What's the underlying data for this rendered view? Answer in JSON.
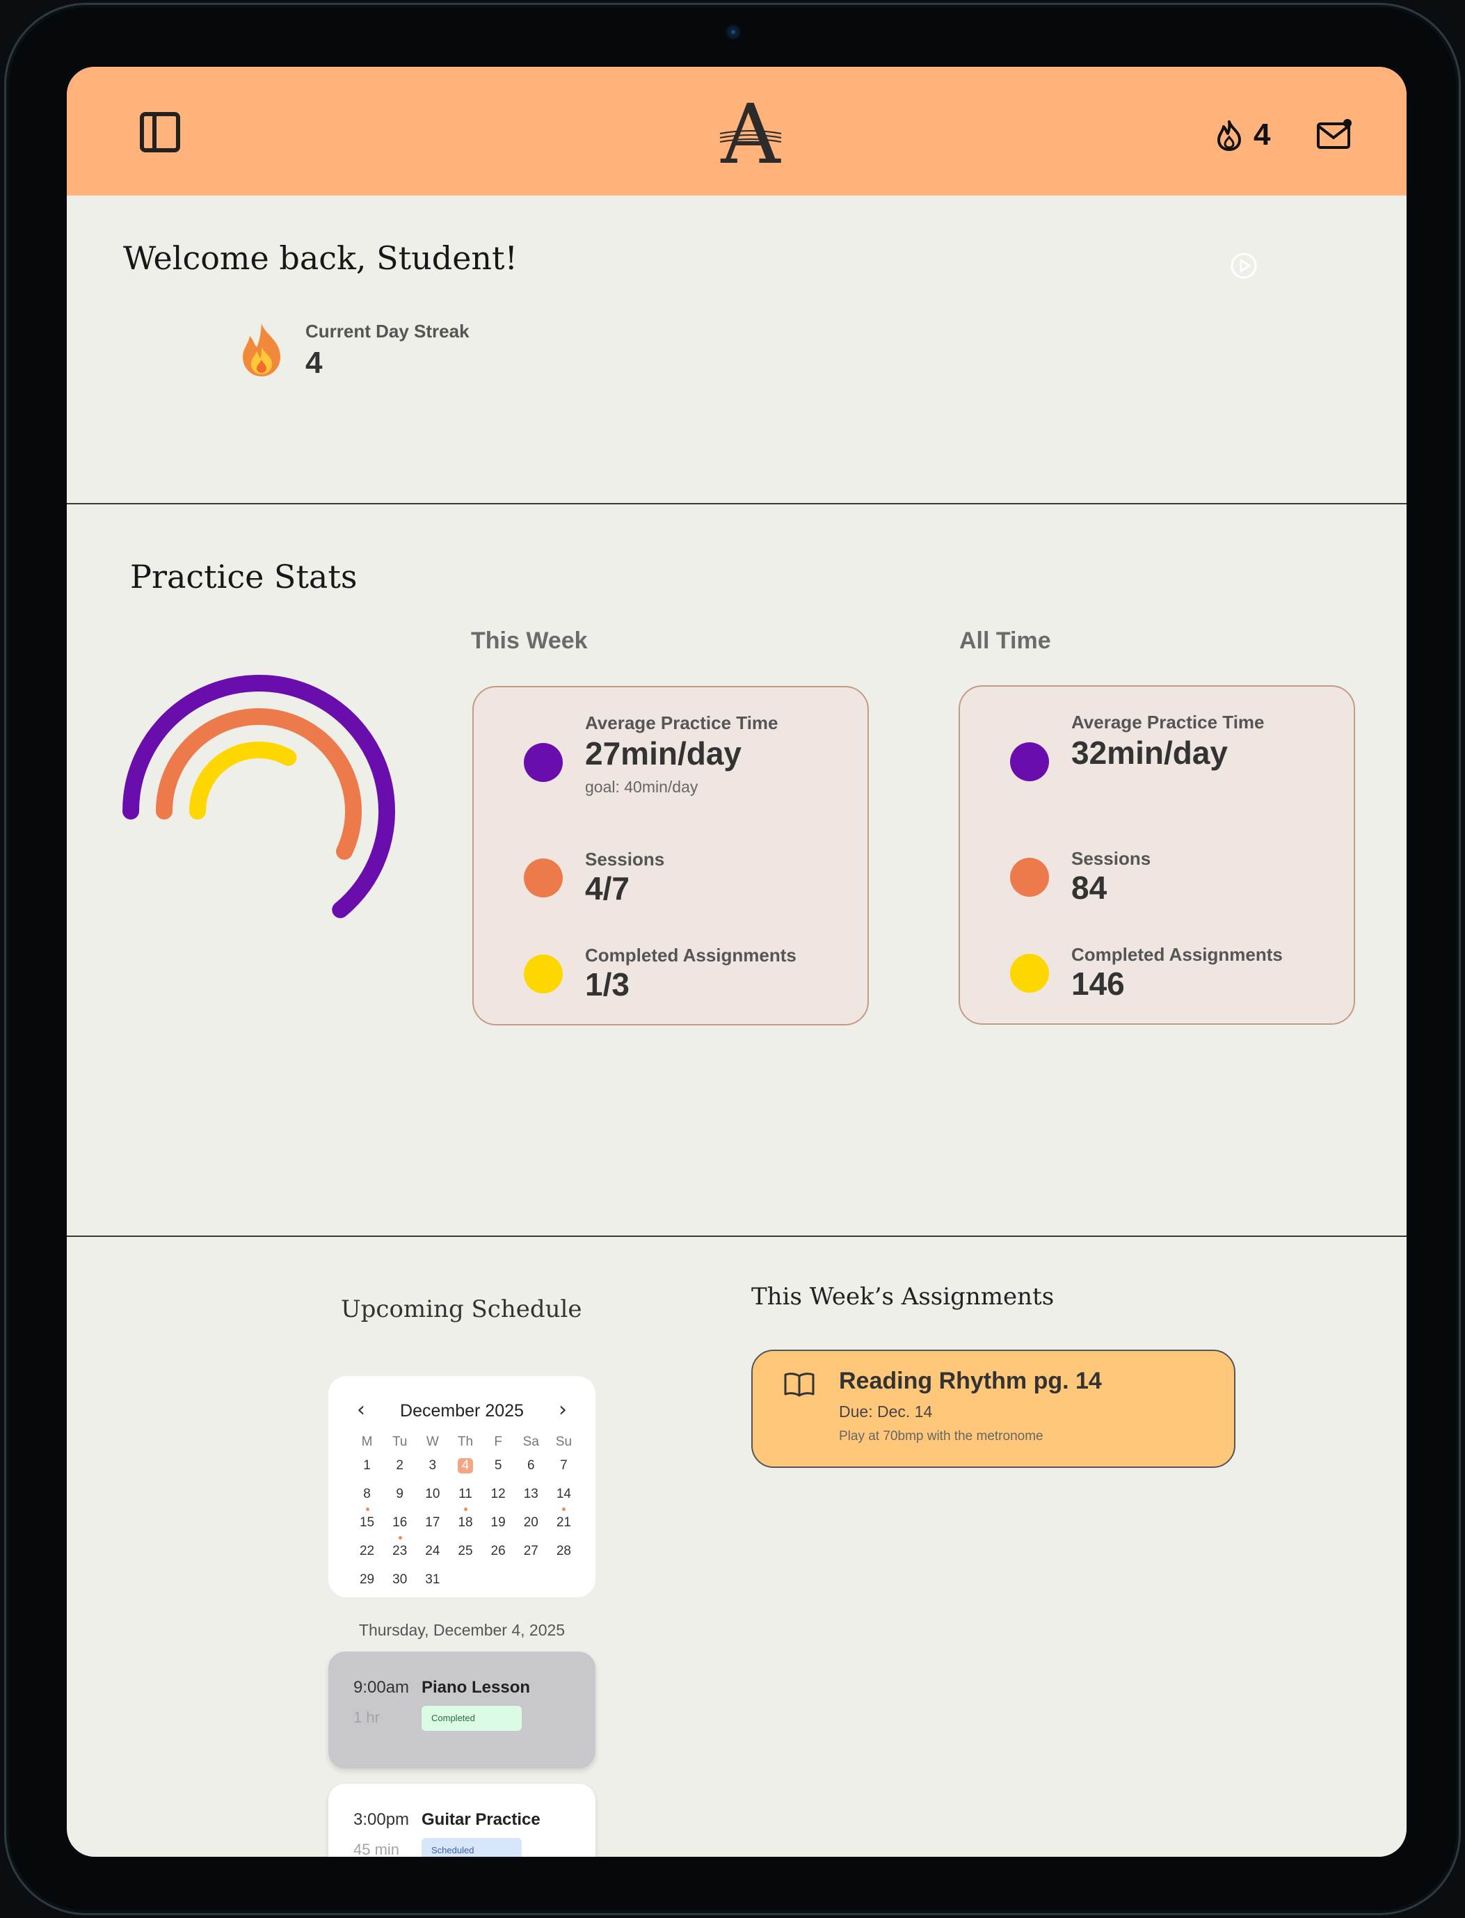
{
  "app": {
    "logo_letter": "A",
    "colors": {
      "header": "#ffb27a",
      "background": "#efefe9",
      "purple": "#6a0dad",
      "orange": "#ec7a4a",
      "yellow": "#ffd700",
      "card": "#f0e6e1",
      "assignment": "#ffc77a"
    }
  },
  "header": {
    "sidebar_icon": "sidebar-toggle-icon",
    "streak_icon": "flame-icon",
    "streak_count": "4",
    "mail_icon": "mail-notification-icon"
  },
  "welcome": {
    "title": "Welcome back, Student!",
    "streak_label": "Current Day Streak",
    "streak_value": "4"
  },
  "practice_stats": {
    "title": "Practice Stats",
    "ring_progress": {
      "purple": 0.64,
      "orange": 0.57,
      "yellow": 0.33
    },
    "this_week": {
      "title": "This Week",
      "avg_label": "Average Practice Time",
      "avg_value": "27min/day",
      "avg_goal": "goal: 40min/day",
      "sessions_label": "Sessions",
      "sessions_value": "4/7",
      "assign_label": "Completed Assignments",
      "assign_value": "1/3"
    },
    "all_time": {
      "title": "All Time",
      "avg_label": "Average Practice Time",
      "avg_value": "32min/day",
      "sessions_label": "Sessions",
      "sessions_value": "84",
      "assign_label": "Completed Assignments",
      "assign_value": "146"
    }
  },
  "schedule": {
    "title": "Upcoming Schedule",
    "calendar": {
      "month": "December 2025",
      "prev": "‹",
      "next": "›",
      "weekdays": [
        "M",
        "Tu",
        "W",
        "Th",
        "F",
        "Sa",
        "Su"
      ],
      "days": [
        "1",
        "2",
        "3",
        "4",
        "5",
        "6",
        "7",
        "8",
        "9",
        "10",
        "11",
        "12",
        "13",
        "14",
        "15",
        "16",
        "17",
        "18",
        "19",
        "20",
        "21",
        "22",
        "23",
        "24",
        "25",
        "26",
        "27",
        "28",
        "29",
        "30",
        "31"
      ],
      "today": "4",
      "marked": [
        "8",
        "11",
        "14",
        "16"
      ]
    },
    "selected_date": "Thursday, December 4, 2025",
    "events": [
      {
        "time": "9:00am",
        "duration": "1 hr",
        "title": "Piano Lesson",
        "status": "Completed"
      },
      {
        "time": "3:00pm",
        "duration": "45 min",
        "title": "Guitar Practice",
        "status": "Scheduled"
      }
    ]
  },
  "assignments": {
    "title": "This Week’s Assignments",
    "items": [
      {
        "icon": "open-book-icon",
        "name": "Reading Rhythm pg. 14",
        "due": "Due: Dec. 14",
        "note": "Play at 70bmp with the metronome"
      }
    ]
  }
}
